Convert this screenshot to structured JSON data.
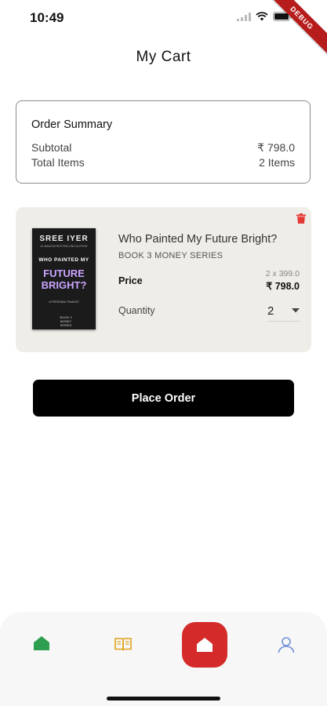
{
  "status_bar": {
    "time": "10:49",
    "debug_label": "DEBUG"
  },
  "header": {
    "title": "My Cart"
  },
  "summary": {
    "title": "Order Summary",
    "subtotal_label": "Subtotal",
    "subtotal_value": "₹ 798.0",
    "items_label": "Total Items",
    "items_value": "2 Items"
  },
  "cart_item": {
    "cover": {
      "author": "SREE IYER",
      "tagline": "#1 AMAZON BESTSELLING AUTHOR",
      "line1": "WHO PAINTED MY",
      "line2": "FUTURE",
      "line3": "BRIGHT?",
      "subtitle": "A PERSONAL FINANCE",
      "series": "BOOK 3 MONEY SERIES"
    },
    "title": "Who Painted My Future Bright?",
    "series": "BOOK 3 MONEY SERIES",
    "price_label": "Price",
    "unit_price": "2 x 399.0",
    "total_price": "₹ 798.0",
    "quantity_label": "Quantity",
    "quantity_value": "2"
  },
  "actions": {
    "place_order": "Place Order"
  },
  "bottom_nav": {
    "items": [
      {
        "icon": "home-icon",
        "color": "#2e9e4f"
      },
      {
        "icon": "book-icon",
        "color": "#e0a21a"
      },
      {
        "icon": "home-icon",
        "color": "#d42a2a"
      },
      {
        "icon": "user-icon",
        "color": "#6f8fd8"
      }
    ]
  }
}
